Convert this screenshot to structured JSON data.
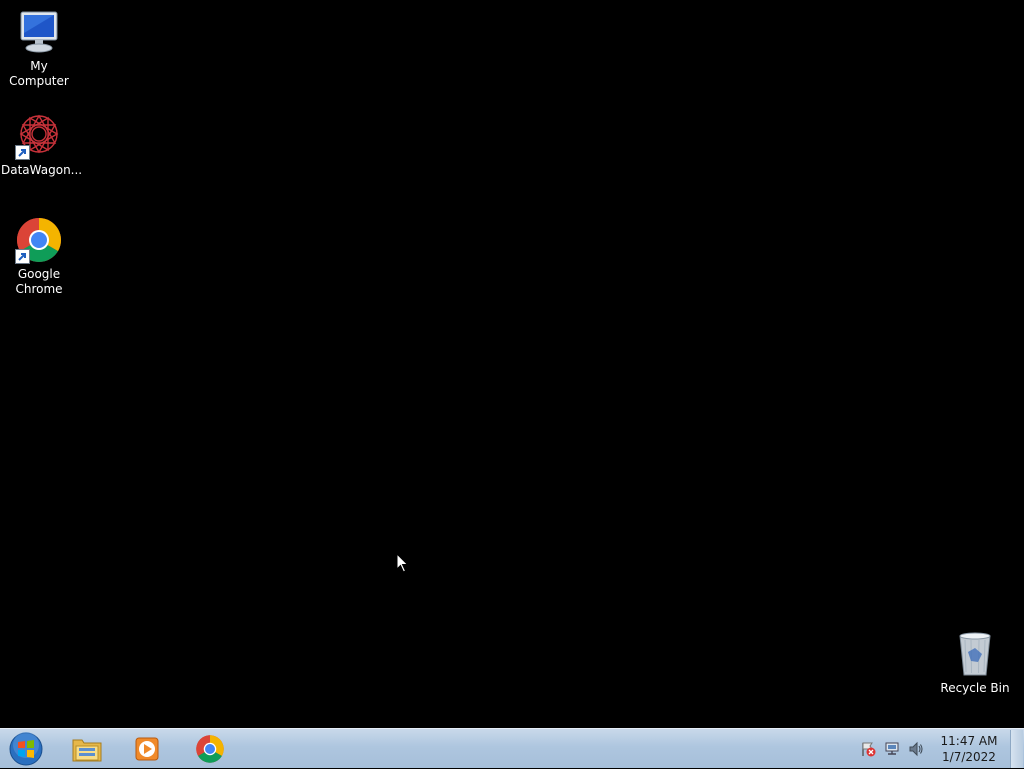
{
  "desktop": {
    "icons": [
      {
        "label": "My Computer",
        "icon": "computer-icon"
      },
      {
        "label": "DataWagon...",
        "icon": "datawagon-icon",
        "shortcut": true
      },
      {
        "label": "Google\nChrome",
        "icon": "chrome-icon",
        "shortcut": true
      },
      {
        "label": "Recycle Bin",
        "icon": "recycle-bin-icon"
      }
    ]
  },
  "taskbar": {
    "start_icon": "windows-orb-icon",
    "pinned": [
      {
        "name": "Windows Explorer",
        "icon": "folder-icon"
      },
      {
        "name": "Windows Media Player",
        "icon": "media-player-icon"
      },
      {
        "name": "Google Chrome",
        "icon": "chrome-icon"
      }
    ],
    "tray": {
      "icons": [
        "action-center-flag-icon",
        "network-icon",
        "volume-icon"
      ],
      "time": "11:47 AM",
      "date": "1/7/2022"
    }
  },
  "colors": {
    "desktop_background": "#000000",
    "taskbar": "#aec6df"
  }
}
